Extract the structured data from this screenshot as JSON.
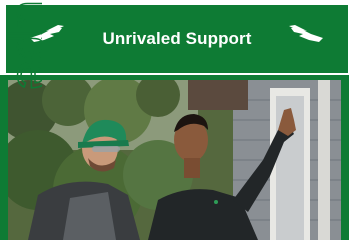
{
  "banner": {
    "title": "Unrivaled Support",
    "left_icon": "handshake-left-icon",
    "right_icon": "handshake-right-icon"
  },
  "side_text": {
    "fragment": "upe"
  },
  "colors": {
    "brand_green": "#0e7b34",
    "banner_text": "#ffffff"
  },
  "photo": {
    "subject": "photo-two-technicians"
  }
}
